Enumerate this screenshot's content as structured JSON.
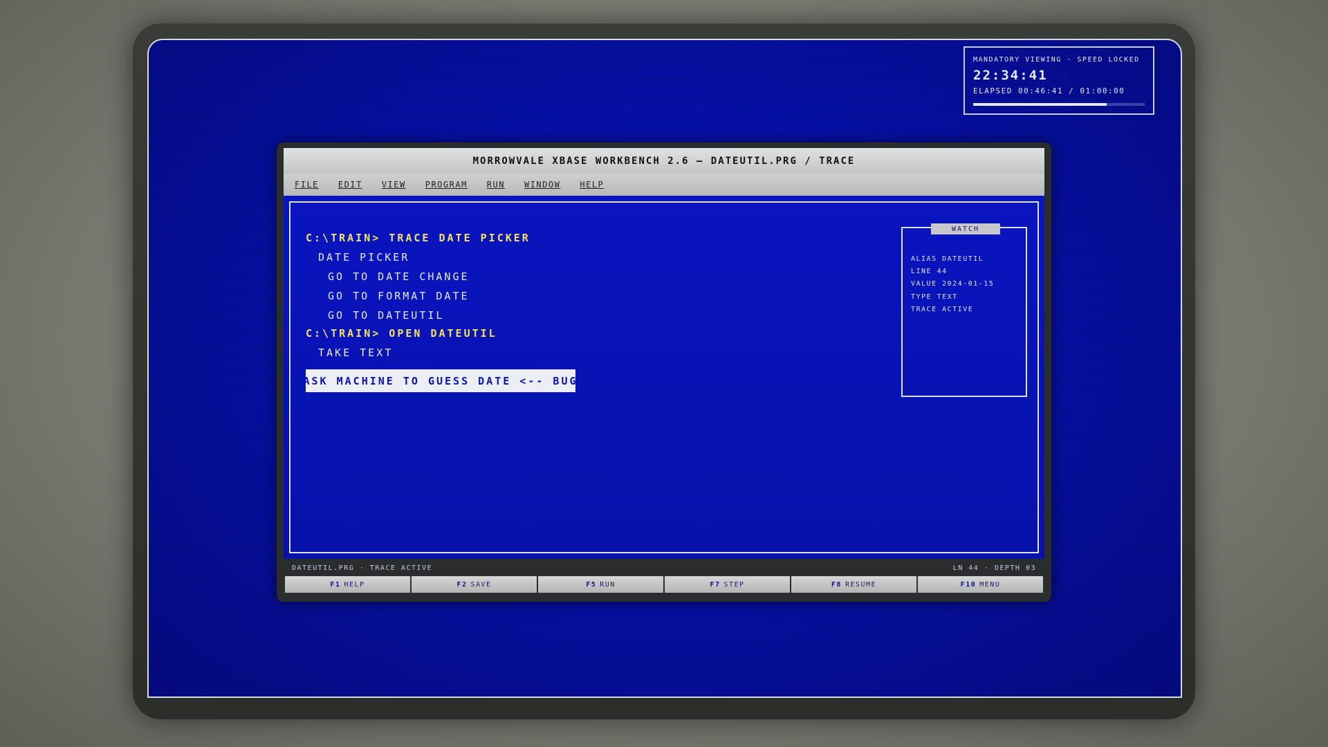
{
  "timer": {
    "mode_label": "MANDATORY VIEWING · SPEED LOCKED",
    "clock": "22:34:41",
    "elapsed": "ELAPSED 00:46:41 / 01:00:00",
    "progress": 0.778
  },
  "window": {
    "title": "MORROWVALE XBASE WORKBENCH 2.6 — DATEUTIL.PRG / TRACE"
  },
  "menu": [
    "FILE",
    "EDIT",
    "VIEW",
    "PROGRAM",
    "RUN",
    "WINDOW",
    "HELP"
  ],
  "editor": {
    "lines": [
      {
        "text": "C:\\TRAIN> TRACE DATE PICKER",
        "kind": "prompt"
      },
      {
        "text": "DATE PICKER",
        "kind": "output"
      },
      {
        "text": "GO TO DATE CHANGE",
        "kind": "output"
      },
      {
        "text": "GO TO FORMAT DATE",
        "kind": "output"
      },
      {
        "text": "GO TO DATEUTIL",
        "kind": "output"
      },
      {
        "text": "C:\\TRAIN> OPEN DATEUTIL",
        "kind": "prompt"
      },
      {
        "text": "TAKE TEXT",
        "kind": "output"
      }
    ],
    "highlighted_line": "ASK MACHINE TO GUESS DATE <-- BUG"
  },
  "watch": {
    "title": "WATCH",
    "rows": [
      "ALIAS DATEUTIL",
      "LINE 44",
      "VALUE 2024-01-15",
      "TYPE TEXT",
      "TRACE ACTIVE"
    ]
  },
  "status": {
    "left": "DATEUTIL.PRG · TRACE ACTIVE",
    "right": "LN 44 · DEPTH 03"
  },
  "fkeys": [
    {
      "key": "F1",
      "label": "HELP"
    },
    {
      "key": "F2",
      "label": "SAVE"
    },
    {
      "key": "F5",
      "label": "RUN"
    },
    {
      "key": "F7",
      "label": "STEP"
    },
    {
      "key": "F8",
      "label": "RESUME"
    },
    {
      "key": "F10",
      "label": "MENU"
    }
  ]
}
